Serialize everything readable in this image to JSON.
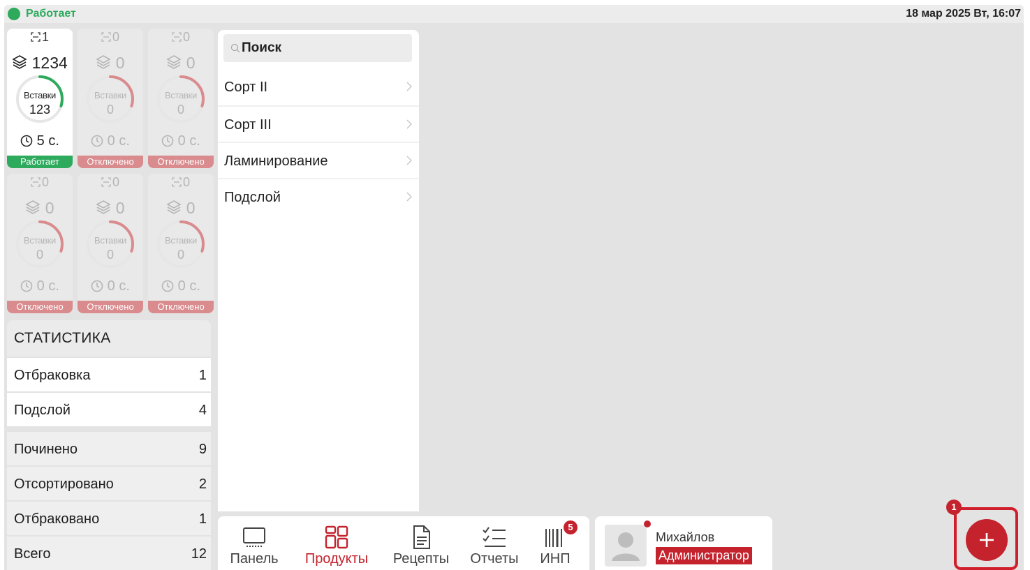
{
  "statusbar": {
    "status": "Работает",
    "datetime": "18 мар 2025 Вт, 16:07"
  },
  "tiles": [
    {
      "top_count": "1",
      "stack": "1234",
      "ring_label": "Вставки",
      "ring_value": "123",
      "time": "5 с.",
      "status": "Работает",
      "progress": 0.3
    },
    {
      "top_count": "0",
      "stack": "0",
      "ring_label": "Вставки",
      "ring_value": "0",
      "time": "0 с.",
      "status": "Отключено",
      "progress": 0.3
    },
    {
      "top_count": "0",
      "stack": "0",
      "ring_label": "Вставки",
      "ring_value": "0",
      "time": "0 с.",
      "status": "Отключено",
      "progress": 0.3
    },
    {
      "top_count": "0",
      "stack": "0",
      "ring_label": "Вставки",
      "ring_value": "0",
      "time": "0 с.",
      "status": "Отключено",
      "progress": 0.3
    },
    {
      "top_count": "0",
      "stack": "0",
      "ring_label": "Вставки",
      "ring_value": "0",
      "time": "0 с.",
      "status": "Отключено",
      "progress": 0.3
    },
    {
      "top_count": "0",
      "stack": "0",
      "ring_label": "Вставки",
      "ring_value": "0",
      "time": "0 с.",
      "status": "Отключено",
      "progress": 0.3
    }
  ],
  "statistics": {
    "title": "СТАТИСТИКА",
    "rows": [
      {
        "label": "Отбраковка",
        "value": "1"
      },
      {
        "label": "Подслой",
        "value": "4"
      },
      {
        "label": "Починено",
        "value": "9"
      },
      {
        "label": "Отсортировано",
        "value": "2"
      },
      {
        "label": "Отбраковано",
        "value": "1"
      },
      {
        "label": "Всего",
        "value": "12"
      }
    ]
  },
  "products": {
    "search_placeholder": "Поиск",
    "items": [
      "Сорт II",
      "Сорт III",
      "Ламинирование",
      "Подслой"
    ]
  },
  "tabs": [
    {
      "label": "Панель",
      "icon": "monitor-icon"
    },
    {
      "label": "Продукты",
      "icon": "grid-icon"
    },
    {
      "label": "Рецепты",
      "icon": "document-icon"
    },
    {
      "label": "Отчеты",
      "icon": "checklist-icon"
    },
    {
      "label": "ИНП",
      "icon": "barcode-icon",
      "badge": "5"
    }
  ],
  "user": {
    "name": "Михайлов",
    "role": "Администратор"
  },
  "add": {
    "step": "1"
  },
  "colors": {
    "accent": "#c4232e",
    "ok": "#2eaa5d",
    "off": "#d98b8e"
  }
}
